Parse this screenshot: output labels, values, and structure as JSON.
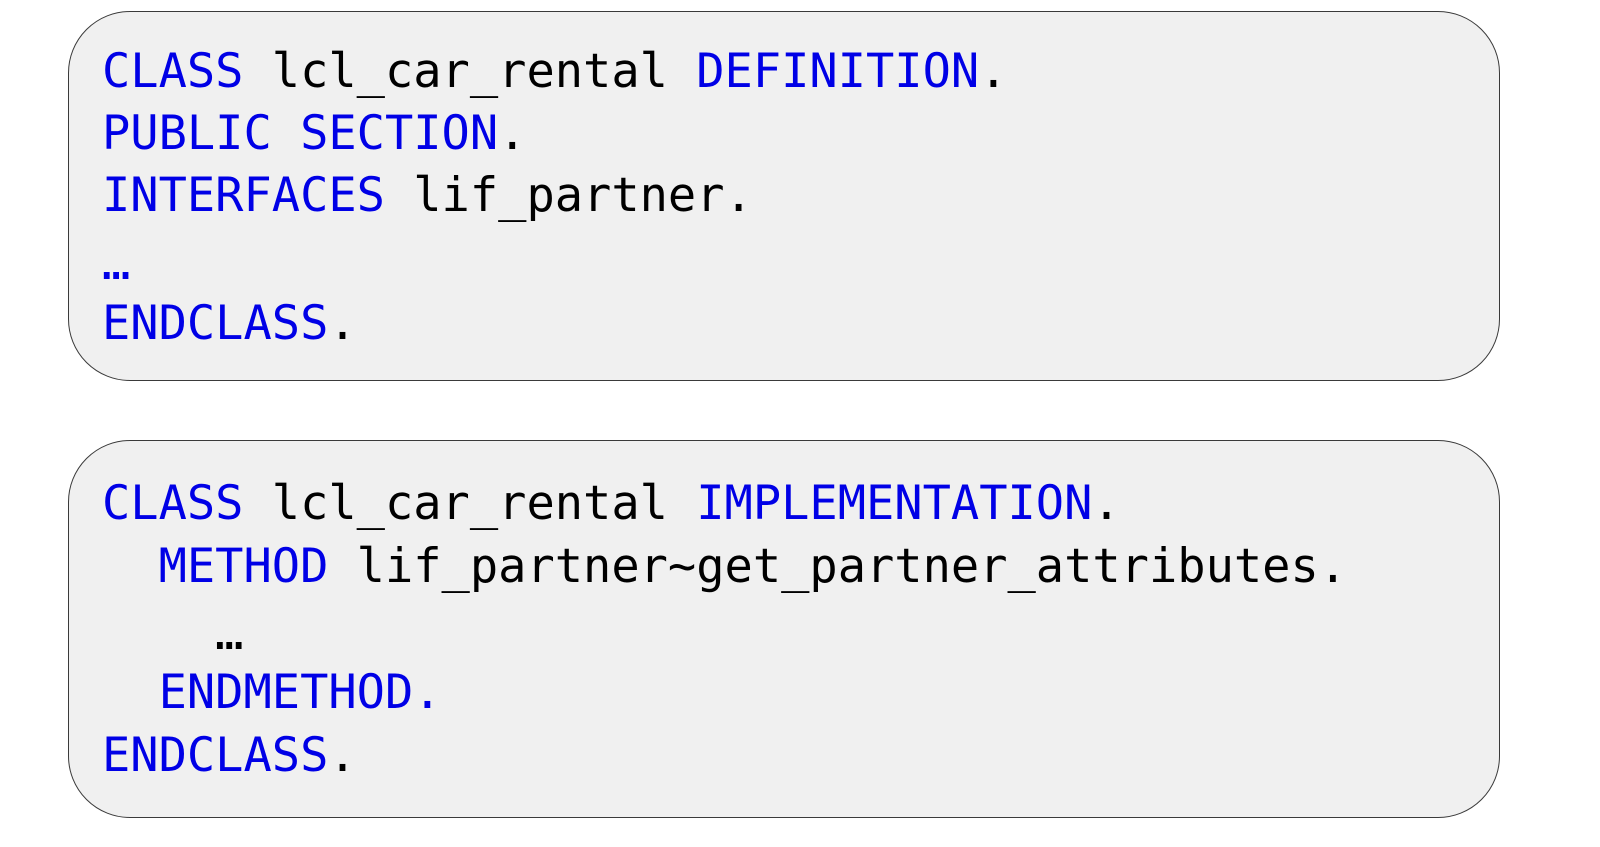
{
  "colors": {
    "keyword": "#0000e6",
    "text": "#000000",
    "box_fill": "#f0f0f0",
    "box_border": "#3a3a3a"
  },
  "definition_block": {
    "line1": {
      "kw1": "CLASS",
      "name": " lcl_car_rental ",
      "kw2": "DEFINITION",
      "end": "."
    },
    "line2": {
      "kw1": "PUBLIC SECTION",
      "end": "."
    },
    "line3": {
      "kw1": "INTERFACES",
      "rest": " lif_partner."
    },
    "line4": {
      "text": "…"
    },
    "line5": {
      "kw1": "ENDCLASS",
      "end": "."
    }
  },
  "implementation_block": {
    "line1": {
      "kw1": "CLASS",
      "name": " lcl_car_rental ",
      "kw2": "IMPLEMENTATION",
      "end": "."
    },
    "line2": {
      "indent": "  ",
      "kw1": "METHOD",
      "rest": " lif_partner~get_partner_attributes."
    },
    "line3": {
      "text": "    …"
    },
    "line4": {
      "indent": "  ",
      "kw1": "ENDMETHOD."
    },
    "line5": {
      "kw1": "ENDCLASS",
      "end": "."
    }
  }
}
